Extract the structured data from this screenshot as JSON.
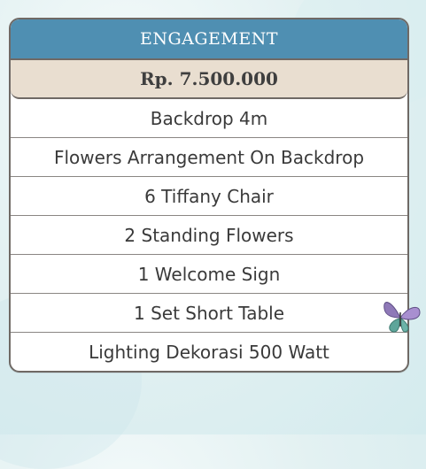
{
  "package": {
    "title": "ENGAGEMENT",
    "price": "Rp. 7.500.000",
    "items": [
      "Backdrop 4m",
      "Flowers Arrangement On Backdrop",
      "6 Tiffany Chair",
      "2 Standing Flowers",
      "1 Welcome Sign",
      "1 Set Short Table",
      "Lighting Dekorasi 500 Watt"
    ]
  },
  "colors": {
    "header_bg": "#4f8fb2",
    "price_bg": "#e9ded0",
    "border": "#6f6965",
    "background": "#e3f1f2"
  },
  "decoration": {
    "icon": "butterfly-icon"
  }
}
